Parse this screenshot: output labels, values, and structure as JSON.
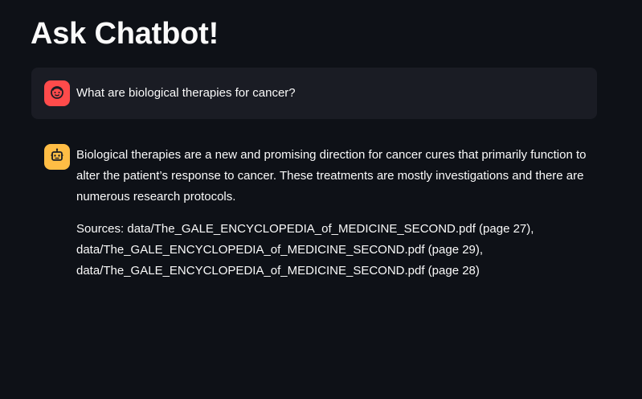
{
  "page": {
    "title": "Ask Chatbot!"
  },
  "chat": {
    "user_message": {
      "avatar_icon": "user-face-icon",
      "text": "What are biological therapies for cancer?"
    },
    "assistant_message": {
      "avatar_icon": "robot-icon",
      "answer": "Biological therapies are a new and promising direction for cancer cures that primarily function to alter the patient’s response to cancer. These treatments are mostly investigations and there are numerous research protocols.",
      "sources_lines": [
        "Sources: data/The_GALE_ENCYCLOPEDIA_of_MEDICINE_SECOND.pdf (page 27),",
        "data/The_GALE_ENCYCLOPEDIA_of_MEDICINE_SECOND.pdf (page 29),",
        "data/The_GALE_ENCYCLOPEDIA_of_MEDICINE_SECOND.pdf (page 28)"
      ]
    }
  },
  "colors": {
    "background": "#0e1117",
    "user_bubble": "#1a1c24",
    "user_avatar": "#ff4b4b",
    "assistant_avatar": "#ffbd45",
    "text": "#fafafa"
  }
}
